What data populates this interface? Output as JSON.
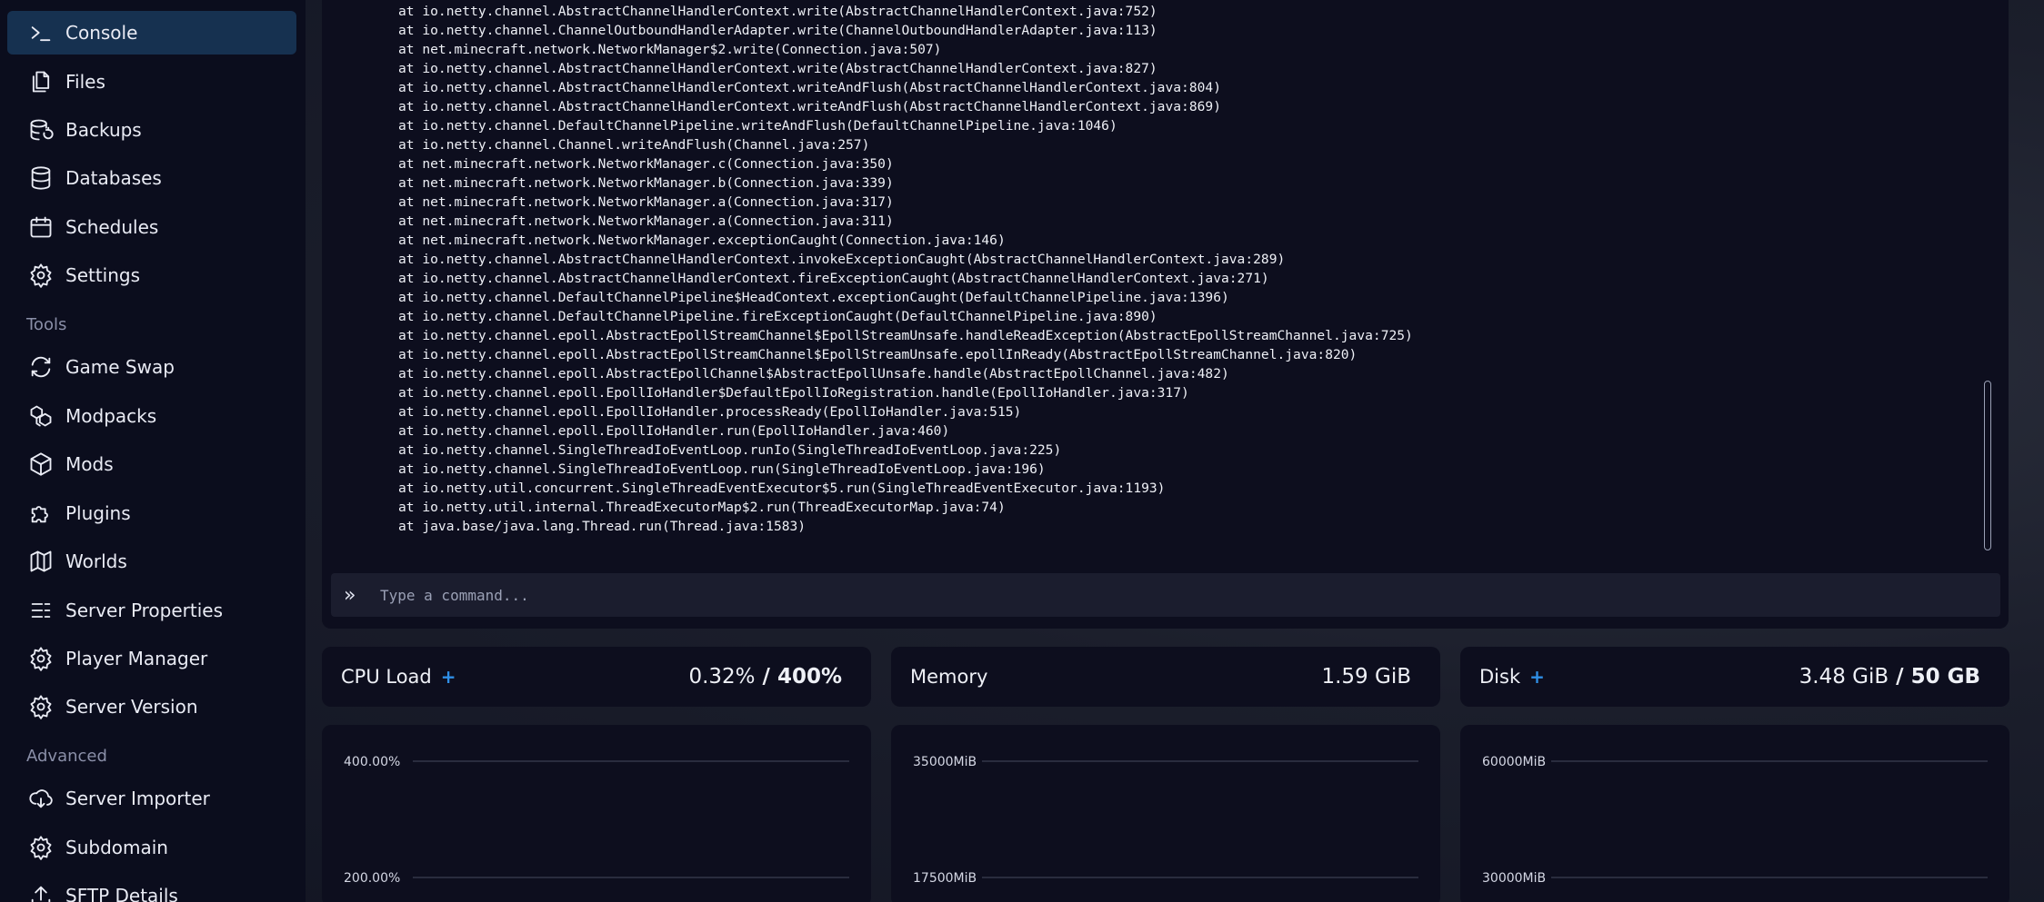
{
  "sidebar": {
    "items": [
      {
        "label": "Console",
        "icon": "terminal-icon",
        "active": true
      },
      {
        "label": "Files",
        "icon": "files-icon"
      },
      {
        "label": "Backups",
        "icon": "backups-icon"
      },
      {
        "label": "Databases",
        "icon": "database-icon"
      },
      {
        "label": "Schedules",
        "icon": "calendar-icon"
      },
      {
        "label": "Settings",
        "icon": "gear-icon"
      }
    ],
    "tools_heading": "Tools",
    "tools": [
      {
        "label": "Game Swap",
        "icon": "swap-icon"
      },
      {
        "label": "Modpacks",
        "icon": "modpacks-icon"
      },
      {
        "label": "Mods",
        "icon": "cube-icon"
      },
      {
        "label": "Plugins",
        "icon": "puzzle-icon"
      },
      {
        "label": "Worlds",
        "icon": "map-icon"
      },
      {
        "label": "Server Properties",
        "icon": "list-settings-icon"
      },
      {
        "label": "Player Manager",
        "icon": "gear-icon"
      },
      {
        "label": "Server Version",
        "icon": "gear-icon"
      }
    ],
    "advanced_heading": "Advanced",
    "advanced": [
      {
        "label": "Server Importer",
        "icon": "cloud-download-icon"
      },
      {
        "label": "Subdomain",
        "icon": "gear-icon"
      },
      {
        "label": "SFTP Details",
        "icon": "upload-icon"
      }
    ]
  },
  "console": {
    "lines": [
      "at io.netty.channel.AbstractChannelHandlerContext.write(AbstractChannelHandlerContext.java:752)",
      "at io.netty.channel.ChannelOutboundHandlerAdapter.write(ChannelOutboundHandlerAdapter.java:113)",
      "at net.minecraft.network.NetworkManager$2.write(Connection.java:507)",
      "at io.netty.channel.AbstractChannelHandlerContext.write(AbstractChannelHandlerContext.java:827)",
      "at io.netty.channel.AbstractChannelHandlerContext.writeAndFlush(AbstractChannelHandlerContext.java:804)",
      "at io.netty.channel.AbstractChannelHandlerContext.writeAndFlush(AbstractChannelHandlerContext.java:869)",
      "at io.netty.channel.DefaultChannelPipeline.writeAndFlush(DefaultChannelPipeline.java:1046)",
      "at io.netty.channel.Channel.writeAndFlush(Channel.java:257)",
      "at net.minecraft.network.NetworkManager.c(Connection.java:350)",
      "at net.minecraft.network.NetworkManager.b(Connection.java:339)",
      "at net.minecraft.network.NetworkManager.a(Connection.java:317)",
      "at net.minecraft.network.NetworkManager.a(Connection.java:311)",
      "at net.minecraft.network.NetworkManager.exceptionCaught(Connection.java:146)",
      "at io.netty.channel.AbstractChannelHandlerContext.invokeExceptionCaught(AbstractChannelHandlerContext.java:289)",
      "at io.netty.channel.AbstractChannelHandlerContext.fireExceptionCaught(AbstractChannelHandlerContext.java:271)",
      "at io.netty.channel.DefaultChannelPipeline$HeadContext.exceptionCaught(DefaultChannelPipeline.java:1396)",
      "at io.netty.channel.DefaultChannelPipeline.fireExceptionCaught(DefaultChannelPipeline.java:890)",
      "at io.netty.channel.epoll.AbstractEpollStreamChannel$EpollStreamUnsafe.handleReadException(AbstractEpollStreamChannel.java:725)",
      "at io.netty.channel.epoll.AbstractEpollStreamChannel$EpollStreamUnsafe.epollInReady(AbstractEpollStreamChannel.java:820)",
      "at io.netty.channel.epoll.AbstractEpollChannel$AbstractEpollUnsafe.handle(AbstractEpollChannel.java:482)",
      "at io.netty.channel.epoll.EpollIoHandler$DefaultEpollIoRegistration.handle(EpollIoHandler.java:317)",
      "at io.netty.channel.epoll.EpollIoHandler.processReady(EpollIoHandler.java:515)",
      "at io.netty.channel.epoll.EpollIoHandler.run(EpollIoHandler.java:460)",
      "at io.netty.channel.SingleThreadIoEventLoop.runIo(SingleThreadIoEventLoop.java:225)",
      "at io.netty.channel.SingleThreadIoEventLoop.run(SingleThreadIoEventLoop.java:196)",
      "at io.netty.util.concurrent.SingleThreadEventExecutor$5.run(SingleThreadEventExecutor.java:1193)",
      "at io.netty.util.internal.ThreadExecutorMap$2.run(ThreadExecutorMap.java:74)",
      "at java.base/java.lang.Thread.run(Thread.java:1583)"
    ],
    "command_placeholder": "Type a command...",
    "prompt_symbol": "»"
  },
  "stats": {
    "cpu": {
      "label": "CPU Load",
      "value": "0.32%",
      "limit": "400%",
      "separator": " / "
    },
    "memory": {
      "label": "Memory",
      "value": "1.59 GiB"
    },
    "disk": {
      "label": "Disk",
      "value": "3.48 GiB",
      "limit": "50 GB",
      "separator": " / "
    },
    "plus_symbol": "+"
  },
  "colors": {
    "accent": "#2f8fe6",
    "active_nav": "#163150",
    "panel": "#0d0e1e"
  },
  "chart_data": [
    {
      "type": "line",
      "title": "",
      "xlabel": "",
      "ylabel": "",
      "y_ticks": [
        "400.00%",
        "200.00%"
      ],
      "series": []
    },
    {
      "type": "line",
      "title": "",
      "xlabel": "",
      "ylabel": "",
      "y_ticks": [
        "35000MiB",
        "17500MiB"
      ],
      "series": []
    },
    {
      "type": "line",
      "title": "",
      "xlabel": "",
      "ylabel": "",
      "y_ticks": [
        "60000MiB",
        "30000MiB"
      ],
      "series": []
    }
  ]
}
